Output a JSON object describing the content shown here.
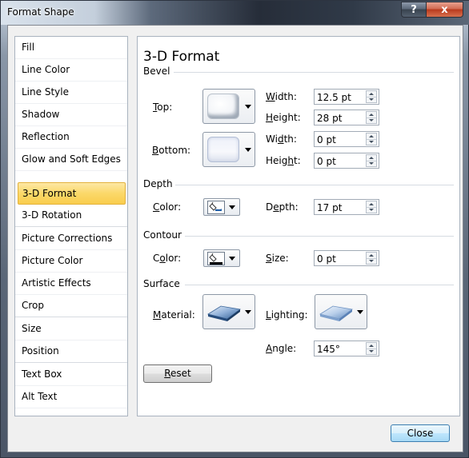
{
  "window": {
    "title": "Format Shape",
    "help_label": "?",
    "close_label": "x"
  },
  "nav": {
    "items": [
      {
        "label": "Fill"
      },
      {
        "label": "Line Color"
      },
      {
        "label": "Line Style"
      },
      {
        "label": "Shadow"
      },
      {
        "label": "Reflection"
      },
      {
        "label": "Glow and Soft Edges"
      },
      {
        "label": "3-D Format",
        "selected": true
      },
      {
        "label": "3-D Rotation"
      },
      {
        "label": "Picture Corrections"
      },
      {
        "label": "Picture Color"
      },
      {
        "label": "Artistic Effects"
      },
      {
        "label": "Crop"
      },
      {
        "label": "Size"
      },
      {
        "label": "Position"
      },
      {
        "label": "Text Box"
      },
      {
        "label": "Alt Text"
      }
    ]
  },
  "panel": {
    "title": "3-D Format",
    "bevel": {
      "section": "Bevel",
      "top_key": "T",
      "top_rest": "op:",
      "bottom_key": "B",
      "bottom_rest": "ottom:",
      "top_width_key": "W",
      "top_width_rest": "idth:",
      "top_width_value": "12.5 pt",
      "top_height_key": "H",
      "top_height_rest": "eight:",
      "top_height_value": "28 pt",
      "bottom_width_pre": "Wi",
      "bottom_width_key": "d",
      "bottom_width_rest": "th:",
      "bottom_width_value": "0 pt",
      "bottom_height_pre": "Heig",
      "bottom_height_key": "h",
      "bottom_height_rest": "t:",
      "bottom_height_value": "0 pt"
    },
    "depth": {
      "section": "Depth",
      "color_key": "C",
      "color_rest": "olor:",
      "depth_pre": "D",
      "depth_key": "e",
      "depth_rest": "pth:",
      "depth_value": "17 pt"
    },
    "contour": {
      "section": "Contour",
      "color_pre": "C",
      "color_key": "o",
      "color_rest": "lor:",
      "size_key": "S",
      "size_rest": "ize:",
      "size_value": "0 pt"
    },
    "surface": {
      "section": "Surface",
      "material_key": "M",
      "material_rest": "aterial:",
      "lighting_key": "L",
      "lighting_rest": "ighting:",
      "angle_key": "A",
      "angle_rest": "ngle:",
      "angle_value": "145°"
    },
    "reset_key": "R",
    "reset_rest": "eset"
  },
  "footer": {
    "close_label": "Close"
  },
  "colors": {
    "selected_bg": "#fbd869",
    "selected_border": "#e3b23c",
    "fill_blue": "#1f5ea8"
  }
}
